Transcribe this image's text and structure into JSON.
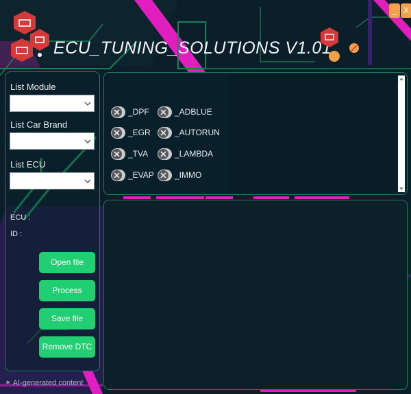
{
  "app": {
    "title": "ECU_TUNING_SOLUTIONS V1.01",
    "minimize_label": "_",
    "close_label": "X"
  },
  "colors": {
    "background": "#0b1f2a",
    "accent_green": "#21cf72",
    "panel_border": "#1d7e58",
    "magenta": "#e11fbf",
    "orange": "#f4a04a",
    "logo_red": "#d43a3a"
  },
  "icons": {
    "logo": "engine-logo-icon",
    "select_arrow": "chevron-down-icon",
    "toggle_off": "x-mark-icon",
    "decoration": "circuit-badge-icon"
  },
  "left_panel": {
    "list_module_label": "List Module",
    "list_module_value": "",
    "list_car_brand_label": "List Car Brand",
    "list_car_brand_value": "",
    "list_ecu_label": "List ECU",
    "list_ecu_value": "",
    "ecu_label": "ECU :",
    "id_label": "ID :"
  },
  "actions": {
    "open_file": "Open file",
    "process": "Process",
    "save_file": "Save file",
    "remove_dtc": "Remove DTC"
  },
  "options": {
    "col1": [
      "_DPF",
      "_EGR",
      "_TVA",
      "_EVAP"
    ],
    "col2": [
      "_ADBLUE",
      "_AUTORUN",
      "_LAMBDA",
      "_IMMO"
    ],
    "states": {
      "_DPF": false,
      "_EGR": false,
      "_TVA": false,
      "_EVAP": false,
      "_ADBLUE": false,
      "_AUTORUN": false,
      "_LAMBDA": false,
      "_IMMO": false
    }
  },
  "footer": {
    "text": "AI-generated content"
  }
}
